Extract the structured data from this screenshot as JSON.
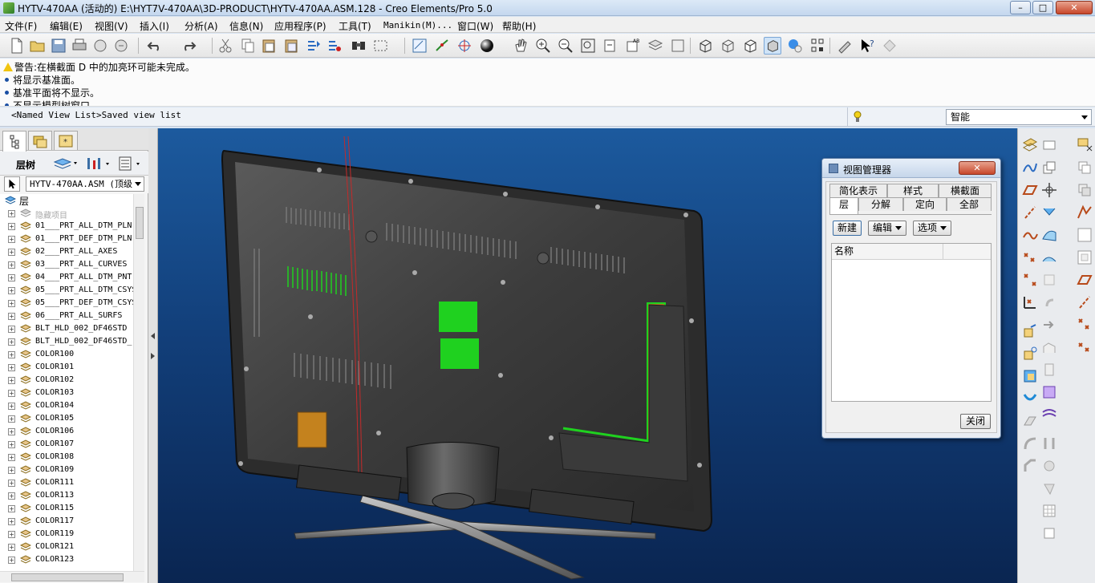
{
  "window": {
    "title": "HYTV-470AA (活动的) E:\\HYT7V-470AA\\3D-PRODUCT\\HYTV-470AA.ASM.128 - Creo Elements/Pro 5.0",
    "minimize_glyph": "–",
    "maximize_glyph": "□",
    "close_glyph": "✕"
  },
  "menubar": {
    "items": [
      "文件(F)",
      "编辑(E)",
      "视图(V)",
      "插入(I)",
      "分析(A)",
      "信息(N)",
      "应用程序(P)",
      "工具(T)",
      "Manikin(M)...",
      "窗口(W)",
      "帮助(H)"
    ]
  },
  "messages": [
    {
      "type": "warning",
      "text": "警告:在横截面 D 中的加亮环可能未完成。"
    },
    {
      "type": "info",
      "text": "将显示基准面。"
    },
    {
      "type": "info",
      "text": "基准平面将不显示。"
    },
    {
      "type": "info",
      "text": "不显示模型树窗口。"
    }
  ],
  "statusrow": {
    "named_views": "<Named View List>Saved view list",
    "filter_value": "智能"
  },
  "leftpanel": {
    "header_label": "层树",
    "model_select": "HYTV-470AA.ASM (顶级",
    "root_label": "层",
    "layers": [
      "隐藏项目",
      "01___PRT_ALL_DTM_PLN",
      "01___PRT_DEF_DTM_PLN",
      "02___PRT_ALL_AXES",
      "03___PRT_ALL_CURVES",
      "04___PRT_ALL_DTM_PNT",
      "05___PRT_ALL_DTM_CSYS",
      "05___PRT_DEF_DTM_CSYS",
      "06___PRT_ALL_SURFS",
      "BLT_HLD_002_DF46STD",
      "BLT_HLD_002_DF46STD_",
      "COLOR100",
      "COLOR101",
      "COLOR102",
      "COLOR103",
      "COLOR104",
      "COLOR105",
      "COLOR106",
      "COLOR107",
      "COLOR108",
      "COLOR109",
      "COLOR111",
      "COLOR113",
      "COLOR115",
      "COLOR117",
      "COLOR119",
      "COLOR121",
      "COLOR123"
    ]
  },
  "view_manager": {
    "title": "视图管理器",
    "tabs_row1": [
      "简化表示",
      "样式",
      "横截面"
    ],
    "tabs_row2": [
      "层",
      "分解",
      "定向",
      "全部"
    ],
    "buttons": {
      "new": "新建",
      "edit": "编辑",
      "options": "选项"
    },
    "list_header": "名称",
    "close_label": "关闭"
  },
  "colors": {
    "viewport_top": "#1c5a9e",
    "viewport_bottom": "#0a2551",
    "accent_green": "#1fd11f",
    "pcb_orange": "#c4821e"
  }
}
